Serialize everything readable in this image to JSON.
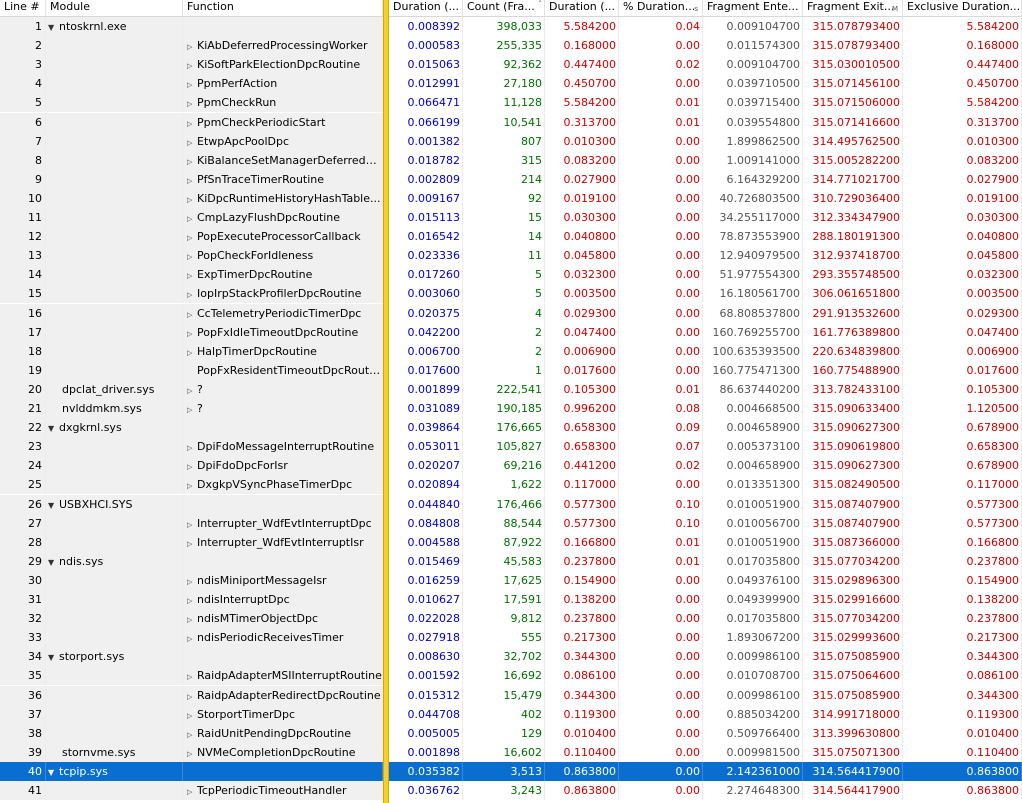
{
  "columns": [
    "Line #",
    "Module",
    "Function",
    "Duration (...",
    "Count (Fra...",
    "Duration (...",
    "% Duration...",
    "Fragment Ente...",
    "Fragment Exit...",
    "Exclusive Duration..."
  ],
  "colors": {
    "selection": "#0a6ed1",
    "separator": "#f7cf2a",
    "duration_ms": "#0000cc",
    "count": "#007000",
    "values_red": "#cc0000"
  },
  "rows": [
    {
      "line": "1",
      "indent": 0,
      "exp": "open",
      "module": "ntoskrnl.exe",
      "function": "",
      "fexp": "",
      "d1": "0.008392",
      "count": "398,033",
      "d2": "5.584200",
      "pct": "0.04",
      "fe": "0.009104700",
      "fx": "315.078793400",
      "ex": "5.584200"
    },
    {
      "line": "2",
      "module": "",
      "function": "KiAbDeferredProcessingWorker",
      "fexp": "closed",
      "d1": "0.000583",
      "count": "255,335",
      "d2": "0.168000",
      "pct": "0.00",
      "fe": "0.011574300",
      "fx": "315.078793400",
      "ex": "0.168000"
    },
    {
      "line": "3",
      "module": "",
      "function": "KiSoftParkElectionDpcRoutine",
      "fexp": "closed",
      "d1": "0.015063",
      "count": "92,362",
      "d2": "0.447400",
      "pct": "0.02",
      "fe": "0.009104700",
      "fx": "315.030010500",
      "ex": "0.447400"
    },
    {
      "line": "4",
      "module": "",
      "function": "PpmPerfAction",
      "fexp": "closed",
      "d1": "0.012991",
      "count": "27,180",
      "d2": "0.450700",
      "pct": "0.00",
      "fe": "0.039710500",
      "fx": "315.071456100",
      "ex": "0.450700"
    },
    {
      "line": "5",
      "module": "",
      "function": "PpmCheckRun",
      "fexp": "closed",
      "d1": "0.066471",
      "count": "11,128",
      "d2": "5.584200",
      "pct": "0.01",
      "fe": "0.039715400",
      "fx": "315.071506000",
      "ex": "5.584200"
    },
    {
      "line": "6",
      "module": "",
      "function": "PpmCheckPeriodicStart",
      "fexp": "closed",
      "d1": "0.066199",
      "count": "10,541",
      "d2": "0.313700",
      "pct": "0.01",
      "fe": "0.039554800",
      "fx": "315.071416600",
      "ex": "0.313700"
    },
    {
      "line": "7",
      "module": "",
      "function": "EtwpApcPoolDpc",
      "fexp": "closed",
      "d1": "0.001382",
      "count": "807",
      "d2": "0.010300",
      "pct": "0.00",
      "fe": "1.899862500",
      "fx": "314.495762500",
      "ex": "0.010300"
    },
    {
      "line": "8",
      "module": "",
      "function": "KiBalanceSetManagerDeferredR...",
      "fexp": "closed",
      "d1": "0.018782",
      "count": "315",
      "d2": "0.083200",
      "pct": "0.00",
      "fe": "1.009141000",
      "fx": "315.005282200",
      "ex": "0.083200"
    },
    {
      "line": "9",
      "module": "",
      "function": "PfSnTraceTimerRoutine",
      "fexp": "closed",
      "d1": "0.002809",
      "count": "214",
      "d2": "0.027900",
      "pct": "0.00",
      "fe": "6.164329200",
      "fx": "314.771021700",
      "ex": "0.027900"
    },
    {
      "line": "10",
      "module": "",
      "function": "KiDpcRuntimeHistoryHashTable...",
      "fexp": "closed",
      "d1": "0.009167",
      "count": "92",
      "d2": "0.019100",
      "pct": "0.00",
      "fe": "40.726803500",
      "fx": "310.729036400",
      "ex": "0.019100"
    },
    {
      "line": "11",
      "module": "",
      "function": "CmpLazyFlushDpcRoutine",
      "fexp": "closed",
      "d1": "0.015113",
      "count": "15",
      "d2": "0.030300",
      "pct": "0.00",
      "fe": "34.255117000",
      "fx": "312.334347900",
      "ex": "0.030300"
    },
    {
      "line": "12",
      "module": "",
      "function": "PopExecuteProcessorCallback",
      "fexp": "closed",
      "d1": "0.016542",
      "count": "14",
      "d2": "0.040800",
      "pct": "0.00",
      "fe": "78.873553900",
      "fx": "288.180191300",
      "ex": "0.040800"
    },
    {
      "line": "13",
      "module": "",
      "function": "PopCheckForIdleness",
      "fexp": "closed",
      "d1": "0.023336",
      "count": "11",
      "d2": "0.045800",
      "pct": "0.00",
      "fe": "12.940979500",
      "fx": "312.937418700",
      "ex": "0.045800"
    },
    {
      "line": "14",
      "module": "",
      "function": "ExpTimerDpcRoutine",
      "fexp": "closed",
      "d1": "0.017260",
      "count": "5",
      "d2": "0.032300",
      "pct": "0.00",
      "fe": "51.977554300",
      "fx": "293.355748500",
      "ex": "0.032300"
    },
    {
      "line": "15",
      "module": "",
      "function": "IopIrpStackProfilerDpcRoutine",
      "fexp": "closed",
      "d1": "0.003060",
      "count": "5",
      "d2": "0.003500",
      "pct": "0.00",
      "fe": "16.180561700",
      "fx": "306.061651800",
      "ex": "0.003500"
    },
    {
      "line": "16",
      "module": "",
      "function": "CcTelemetryPeriodicTimerDpc",
      "fexp": "closed",
      "d1": "0.020375",
      "count": "4",
      "d2": "0.029300",
      "pct": "0.00",
      "fe": "68.808537800",
      "fx": "291.913532600",
      "ex": "0.029300"
    },
    {
      "line": "17",
      "module": "",
      "function": "PopFxIdleTimeoutDpcRoutine",
      "fexp": "closed",
      "d1": "0.042200",
      "count": "2",
      "d2": "0.047400",
      "pct": "0.00",
      "fe": "160.769255700",
      "fx": "161.776389800",
      "ex": "0.047400"
    },
    {
      "line": "18",
      "module": "",
      "function": "HalpTimerDpcRoutine",
      "fexp": "closed",
      "d1": "0.006700",
      "count": "2",
      "d2": "0.006900",
      "pct": "0.00",
      "fe": "100.635393500",
      "fx": "220.634839800",
      "ex": "0.006900"
    },
    {
      "line": "19",
      "module": "",
      "function": "PopFxResidentTimeoutDpcRouti...",
      "fexp": "",
      "d1": "0.017600",
      "count": "1",
      "d2": "0.017600",
      "pct": "0.00",
      "fe": "160.775471300",
      "fx": "160.775488900",
      "ex": "0.017600"
    },
    {
      "line": "20",
      "indent": 1,
      "exp": "",
      "module": "dpclat_driver.sys",
      "function": "?",
      "fexp": "closed",
      "d1": "0.001899",
      "count": "222,541",
      "d2": "0.105300",
      "pct": "0.01",
      "fe": "86.637440200",
      "fx": "313.782433100",
      "ex": "0.105300"
    },
    {
      "line": "21",
      "indent": 1,
      "exp": "",
      "module": "nvlddmkm.sys",
      "function": "?",
      "fexp": "closed",
      "d1": "0.031089",
      "count": "190,185",
      "d2": "0.996200",
      "pct": "0.08",
      "fe": "0.004668500",
      "fx": "315.090633400",
      "ex": "1.120500"
    },
    {
      "line": "22",
      "indent": 0,
      "exp": "open",
      "module": "dxgkrnl.sys",
      "function": "",
      "fexp": "",
      "d1": "0.039864",
      "count": "176,665",
      "d2": "0.658300",
      "pct": "0.09",
      "fe": "0.004658900",
      "fx": "315.090627300",
      "ex": "0.678900"
    },
    {
      "line": "23",
      "module": "",
      "function": "DpiFdoMessageInterruptRoutine",
      "fexp": "closed",
      "d1": "0.053011",
      "count": "105,827",
      "d2": "0.658300",
      "pct": "0.07",
      "fe": "0.005373100",
      "fx": "315.090619800",
      "ex": "0.658300"
    },
    {
      "line": "24",
      "module": "",
      "function": "DpiFdoDpcForIsr",
      "fexp": "closed",
      "d1": "0.020207",
      "count": "69,216",
      "d2": "0.441200",
      "pct": "0.02",
      "fe": "0.004658900",
      "fx": "315.090627300",
      "ex": "0.678900"
    },
    {
      "line": "25",
      "module": "",
      "function": "DxgkpVSyncPhaseTimerDpc",
      "fexp": "closed",
      "d1": "0.020894",
      "count": "1,622",
      "d2": "0.117000",
      "pct": "0.00",
      "fe": "0.013351300",
      "fx": "315.082490500",
      "ex": "0.117000"
    },
    {
      "line": "26",
      "indent": 0,
      "exp": "open",
      "module": "USBXHCI.SYS",
      "function": "",
      "fexp": "",
      "d1": "0.044840",
      "count": "176,466",
      "d2": "0.577300",
      "pct": "0.10",
      "fe": "0.010051900",
      "fx": "315.087407900",
      "ex": "0.577300"
    },
    {
      "line": "27",
      "module": "",
      "function": "Interrupter_WdfEvtInterruptDpc",
      "fexp": "closed",
      "d1": "0.084808",
      "count": "88,544",
      "d2": "0.577300",
      "pct": "0.10",
      "fe": "0.010056700",
      "fx": "315.087407900",
      "ex": "0.577300"
    },
    {
      "line": "28",
      "module": "",
      "function": "Interrupter_WdfEvtInterruptIsr",
      "fexp": "closed",
      "d1": "0.004588",
      "count": "87,922",
      "d2": "0.166800",
      "pct": "0.01",
      "fe": "0.010051900",
      "fx": "315.087366000",
      "ex": "0.166800"
    },
    {
      "line": "29",
      "indent": 0,
      "exp": "open",
      "module": "ndis.sys",
      "function": "",
      "fexp": "",
      "d1": "0.015469",
      "count": "45,583",
      "d2": "0.237800",
      "pct": "0.01",
      "fe": "0.017035800",
      "fx": "315.077034200",
      "ex": "0.237800"
    },
    {
      "line": "30",
      "module": "",
      "function": "ndisMiniportMessageIsr",
      "fexp": "closed",
      "d1": "0.016259",
      "count": "17,625",
      "d2": "0.154900",
      "pct": "0.00",
      "fe": "0.049376100",
      "fx": "315.029896300",
      "ex": "0.154900"
    },
    {
      "line": "31",
      "module": "",
      "function": "ndisInterruptDpc",
      "fexp": "closed",
      "d1": "0.010627",
      "count": "17,591",
      "d2": "0.138200",
      "pct": "0.00",
      "fe": "0.049399900",
      "fx": "315.029916600",
      "ex": "0.138200"
    },
    {
      "line": "32",
      "module": "",
      "function": "ndisMTimerObjectDpc",
      "fexp": "closed",
      "d1": "0.022028",
      "count": "9,812",
      "d2": "0.237800",
      "pct": "0.00",
      "fe": "0.017035800",
      "fx": "315.077034200",
      "ex": "0.237800"
    },
    {
      "line": "33",
      "module": "",
      "function": "ndisPeriodicReceivesTimer",
      "fexp": "closed",
      "d1": "0.027918",
      "count": "555",
      "d2": "0.217300",
      "pct": "0.00",
      "fe": "1.893067200",
      "fx": "315.029993600",
      "ex": "0.217300"
    },
    {
      "line": "34",
      "indent": 0,
      "exp": "open",
      "module": "storport.sys",
      "function": "",
      "fexp": "",
      "d1": "0.008630",
      "count": "32,702",
      "d2": "0.344300",
      "pct": "0.00",
      "fe": "0.009986100",
      "fx": "315.075085900",
      "ex": "0.344300"
    },
    {
      "line": "35",
      "module": "",
      "function": "RaidpAdapterMSIInterruptRoutine",
      "fexp": "closed",
      "d1": "0.001592",
      "count": "16,692",
      "d2": "0.086100",
      "pct": "0.00",
      "fe": "0.010708700",
      "fx": "315.075064600",
      "ex": "0.086100"
    },
    {
      "line": "36",
      "module": "",
      "function": "RaidpAdapterRedirectDpcRoutine",
      "fexp": "closed",
      "d1": "0.015312",
      "count": "15,479",
      "d2": "0.344300",
      "pct": "0.00",
      "fe": "0.009986100",
      "fx": "315.075085900",
      "ex": "0.344300"
    },
    {
      "line": "37",
      "module": "",
      "function": "StorportTimerDpc",
      "fexp": "closed",
      "d1": "0.044708",
      "count": "402",
      "d2": "0.119300",
      "pct": "0.00",
      "fe": "0.885034200",
      "fx": "314.991718000",
      "ex": "0.119300"
    },
    {
      "line": "38",
      "module": "",
      "function": "RaidUnitPendingDpcRoutine",
      "fexp": "closed",
      "d1": "0.005005",
      "count": "129",
      "d2": "0.010400",
      "pct": "0.00",
      "fe": "0.509766400",
      "fx": "313.399630800",
      "ex": "0.010400"
    },
    {
      "line": "39",
      "indent": 1,
      "exp": "",
      "module": "stornvme.sys",
      "function": "NVMeCompletionDpcRoutine",
      "fexp": "closed",
      "d1": "0.001898",
      "count": "16,602",
      "d2": "0.110400",
      "pct": "0.00",
      "fe": "0.009981500",
      "fx": "315.075071300",
      "ex": "0.110400"
    },
    {
      "line": "40",
      "indent": 0,
      "exp": "open",
      "module": "tcpip.sys",
      "function": "",
      "fexp": "",
      "d1": "0.035382",
      "count": "3,513",
      "d2": "0.863800",
      "pct": "0.00",
      "fe": "2.142361000",
      "fx": "314.564417900",
      "ex": "0.863800",
      "selected": true
    },
    {
      "line": "41",
      "module": "",
      "function": "TcpPeriodicTimeoutHandler",
      "fexp": "closed",
      "d1": "0.036762",
      "count": "3,243",
      "d2": "0.863800",
      "pct": "0.00",
      "fe": "2.274648300",
      "fx": "314.564417900",
      "ex": "0.863800"
    }
  ]
}
